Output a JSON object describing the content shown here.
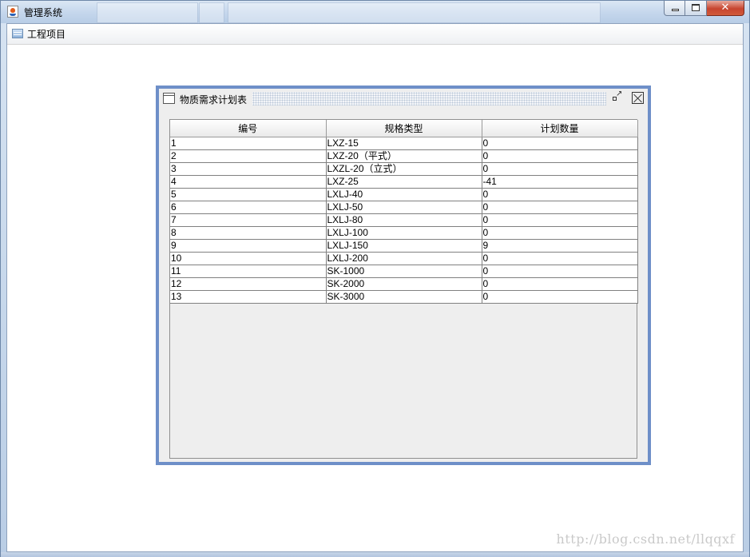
{
  "window": {
    "title": "管理系统"
  },
  "menu": {
    "items": [
      {
        "label": "工程项目"
      }
    ]
  },
  "internal_frame": {
    "title": "物质需求计划表"
  },
  "table": {
    "columns": [
      "编号",
      "规格类型",
      "计划数量"
    ],
    "rows": [
      [
        "1",
        "LXZ-15",
        "0"
      ],
      [
        "2",
        "LXZ-20（平式）",
        "0"
      ],
      [
        "3",
        "LXZL-20（立式）",
        "0"
      ],
      [
        "4",
        "LXZ-25",
        "-41"
      ],
      [
        "5",
        "LXLJ-40",
        "0"
      ],
      [
        "6",
        "LXLJ-50",
        "0"
      ],
      [
        "7",
        "LXLJ-80",
        "0"
      ],
      [
        "8",
        "LXLJ-100",
        "0"
      ],
      [
        "9",
        "LXLJ-150",
        "9"
      ],
      [
        "10",
        "LXLJ-200",
        "0"
      ],
      [
        "11",
        "SK-1000",
        "0"
      ],
      [
        "12",
        "SK-2000",
        "0"
      ],
      [
        "13",
        "SK-3000",
        "0"
      ]
    ]
  },
  "watermark": "http://blog.csdn.net/llqqxf",
  "icons": {
    "app": "java-cup-icon",
    "menu": "menu-item-icon",
    "frame": "window-icon",
    "minimize": "minimize-icon",
    "maximize": "maximize-icon",
    "close": "close-icon",
    "iconify": "iconify-icon"
  },
  "colors": {
    "frame_border": "#6e8fc8",
    "title_bar": "#c4d6ec",
    "close_button": "#c7452f"
  }
}
